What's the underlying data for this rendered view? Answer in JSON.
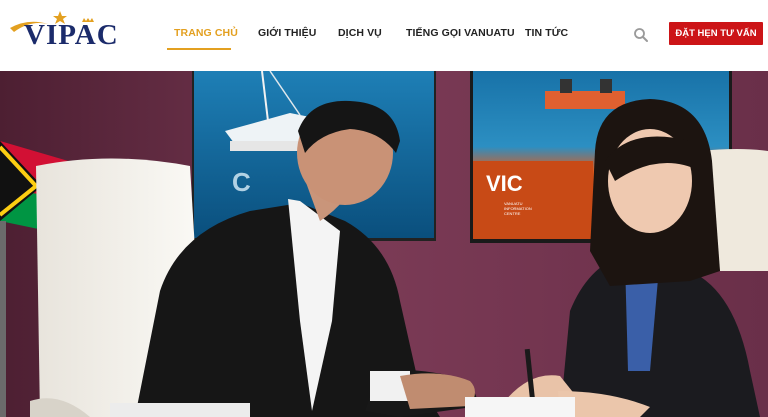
{
  "brand": {
    "logo_text": "VIPAC"
  },
  "nav": {
    "items": [
      {
        "label": "TRANG CHỦ",
        "active": true
      },
      {
        "label": "GIỚI THIỆU",
        "active": false
      },
      {
        "label": "DỊCH VỤ",
        "active": false
      },
      {
        "label": "TIẾNG GỌI VANUATU",
        "active": false
      },
      {
        "label": "TIN TỨC",
        "active": false
      }
    ]
  },
  "header": {
    "cta_label": "ĐẶT HẸN TƯ VẤN",
    "search_icon": "search-icon"
  },
  "hero": {
    "poster_logo": "VIC",
    "poster_caption": "VANUATU\nINFORMATION\nCENTRE"
  },
  "colors": {
    "accent": "#e3a020",
    "cta": "#cc1417",
    "brand_navy": "#1b2b6b",
    "wall": "#6a2f4a"
  }
}
